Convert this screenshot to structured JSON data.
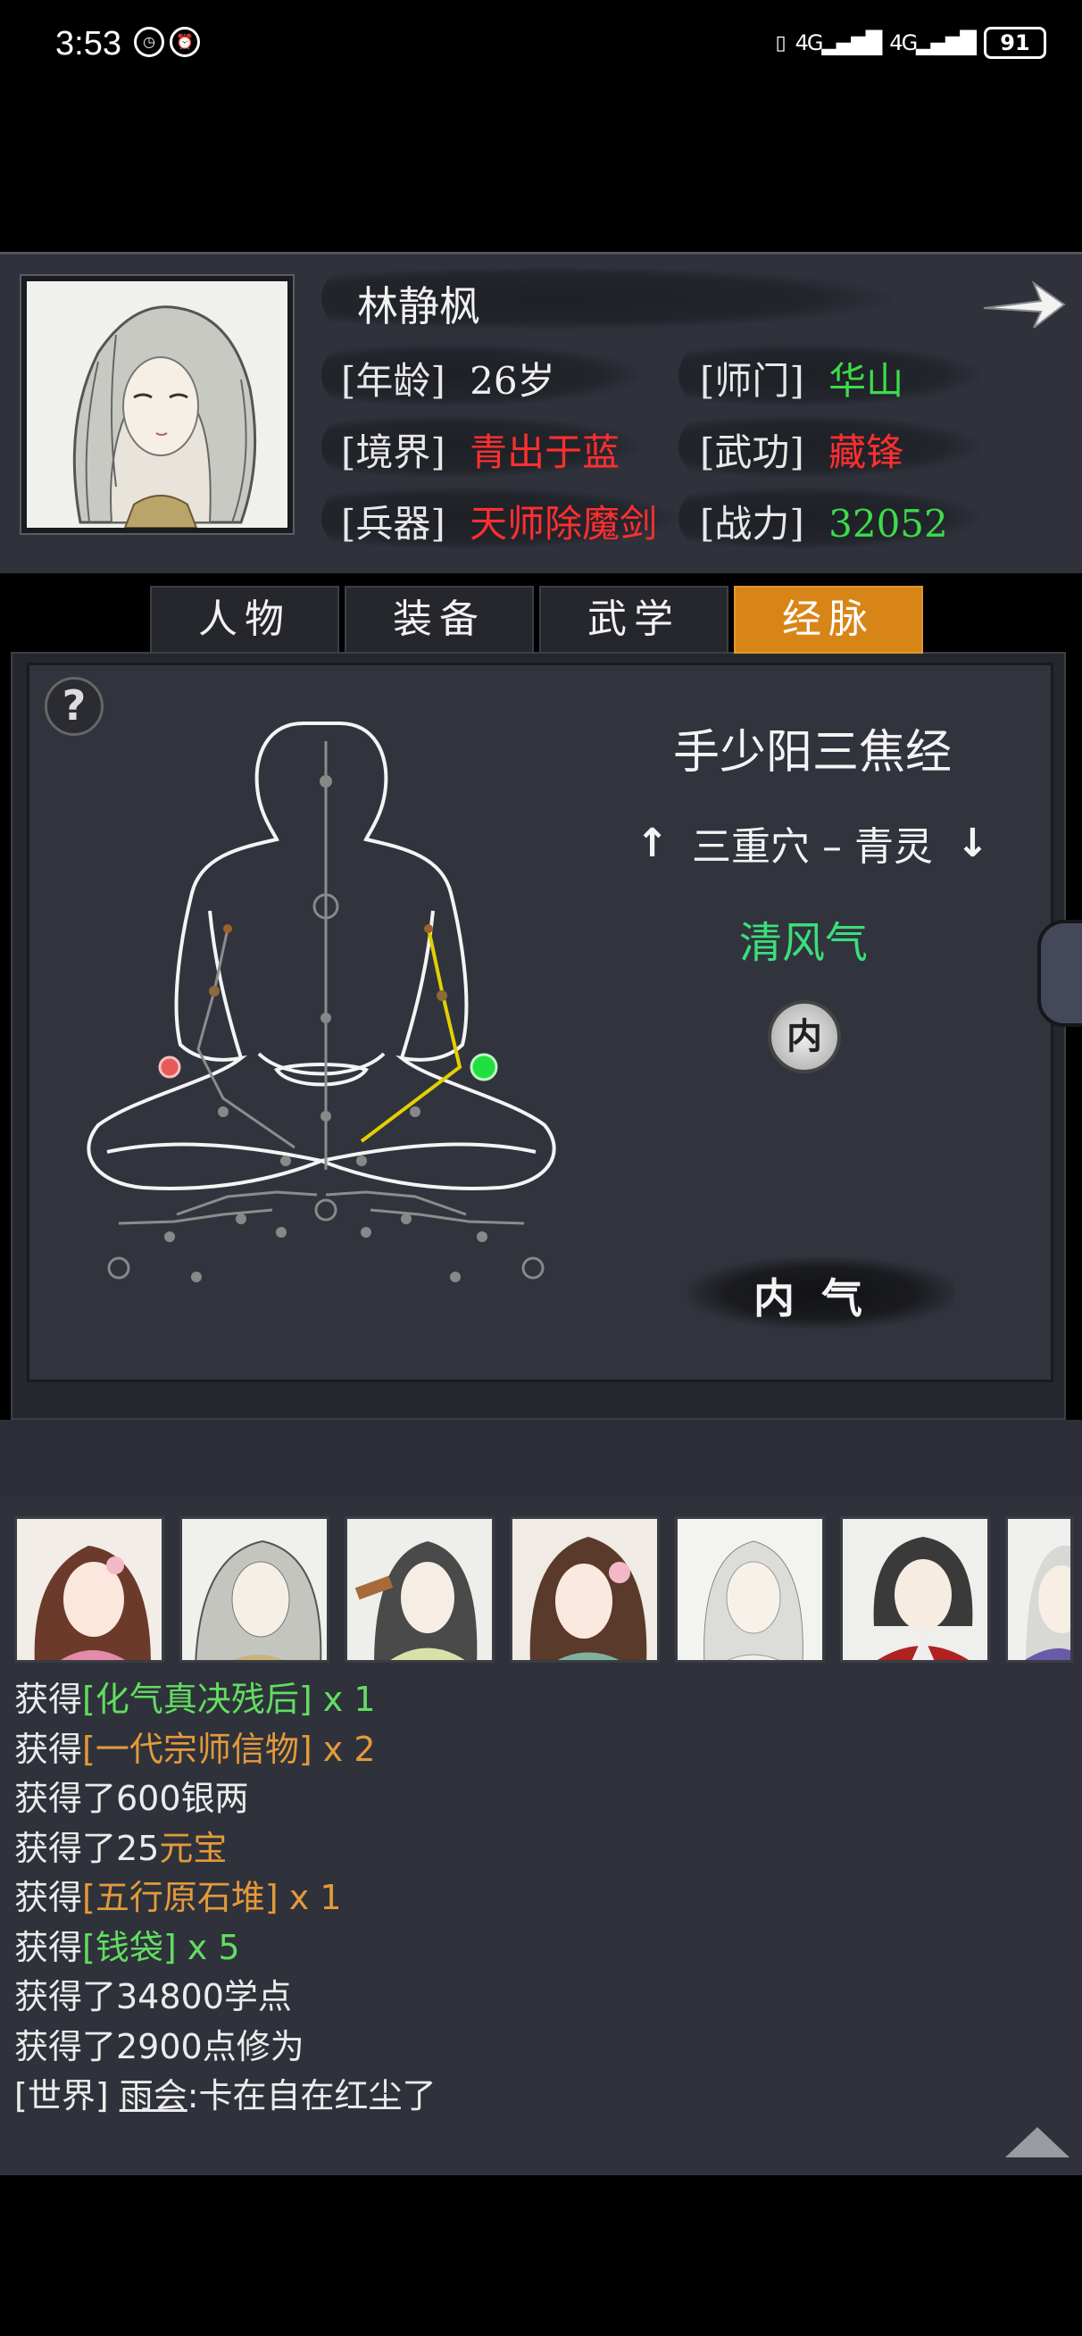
{
  "status_bar": {
    "time": "3:53",
    "battery": "91",
    "network": "4G"
  },
  "profile": {
    "name": "林静枫",
    "age_label": "[年龄]",
    "age": "26岁",
    "sect_label": "[师门]",
    "sect": "华山",
    "realm_label": "[境界]",
    "realm": "青出于蓝",
    "martial_label": "[武功]",
    "martial": "藏锋",
    "weapon_label": "[兵器]",
    "weapon": "天师除魔剑",
    "power_label": "[战力]",
    "power": "32052"
  },
  "tabs": [
    {
      "label": "人物",
      "active": false
    },
    {
      "label": "装备",
      "active": false
    },
    {
      "label": "武学",
      "active": false
    },
    {
      "label": "经脉",
      "active": true
    }
  ],
  "meridian_panel": {
    "help": "?",
    "meridian_name": "手少阳三焦经",
    "acupoint": "三重穴 – 青灵",
    "qi_type": "清风气",
    "nei_badge": "内",
    "nei_qi_button": "内气"
  },
  "chat_log": {
    "lines": [
      [
        {
          "t": "获得",
          "c": "w"
        },
        {
          "t": "[化气真决残后]",
          "c": "g"
        },
        {
          "t": " x 1",
          "c": "g"
        }
      ],
      [
        {
          "t": "获得",
          "c": "w"
        },
        {
          "t": "[一代宗师信物]",
          "c": "o"
        },
        {
          "t": " x 2",
          "c": "o"
        }
      ],
      [
        {
          "t": "获得了600银两",
          "c": "w"
        }
      ],
      [
        {
          "t": "获得了25",
          "c": "w"
        },
        {
          "t": "元宝",
          "c": "o"
        }
      ],
      [
        {
          "t": "获得",
          "c": "w"
        },
        {
          "t": "[五行原石堆]",
          "c": "o"
        },
        {
          "t": " x 1",
          "c": "o"
        }
      ],
      [
        {
          "t": "获得",
          "c": "w"
        },
        {
          "t": "[钱袋]",
          "c": "g"
        },
        {
          "t": " x 5",
          "c": "g"
        }
      ],
      [
        {
          "t": "获得了34800学点",
          "c": "w"
        }
      ],
      [
        {
          "t": "获得了2900点修为",
          "c": "w"
        }
      ],
      [
        {
          "t": "[世界] ",
          "c": "w"
        },
        {
          "t": "雨会",
          "c": "w u"
        },
        {
          "t": ":卡在自在红尘了",
          "c": "w"
        }
      ]
    ]
  },
  "colors": {
    "accent": "#d88518",
    "green": "#3cdc4a",
    "red": "#ff2f2f"
  }
}
